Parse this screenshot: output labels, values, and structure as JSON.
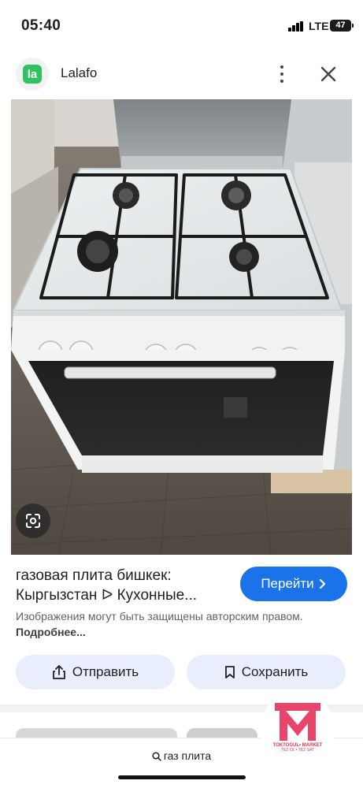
{
  "status": {
    "time": "05:40",
    "network": "LTE",
    "battery": "47"
  },
  "header": {
    "logo_text": "la",
    "site_name": "Lalafo"
  },
  "image": {
    "description_icon": "google-lens-icon"
  },
  "result": {
    "title_line1": "газовая плита бишкек:",
    "title_line2": "Кыргызстан ᐅ Кухонные...",
    "visit_label": "Перейти",
    "disclaimer": "Изображения могут быть защищены авторским правом.",
    "more_link": "Подробнее..."
  },
  "actions": {
    "share_label": "Отправить",
    "save_label": "Сохранить"
  },
  "search": {
    "query": "газ плита"
  },
  "watermark": {
    "line1": "TOKTOGUL• MARKET",
    "line2": "TEZ OL • TEZ SAT"
  },
  "colors": {
    "accent": "#1a73e8",
    "button_bg": "#e8eefb",
    "logo_green": "#2ec262",
    "watermark_pink": "#e8456a"
  }
}
